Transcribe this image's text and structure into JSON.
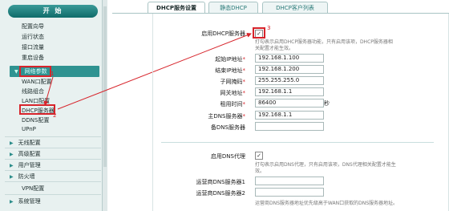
{
  "sidebar": {
    "start_label": "开 始",
    "top_items": [
      "配置向导",
      "运行状态",
      "接口流量",
      "重启设备"
    ],
    "network": {
      "label": "网络参数",
      "items": [
        "WAN口配置",
        "线路组合",
        "LAN口配置",
        "DHCP服务器",
        "DDNS配置",
        "UPnP"
      ]
    },
    "sections": [
      "无线配置",
      "高级配置",
      "用户管理",
      "防火墙",
      "VPN配置",
      "系统管理"
    ]
  },
  "annotations": {
    "one": "1",
    "two": "2",
    "three": "3"
  },
  "tabs": [
    "DHCP服务设置",
    "静态DHCP",
    "DHCP客户列表"
  ],
  "form": {
    "enable_dhcp_label": "启用DHCP服务器",
    "enable_dhcp_checked": true,
    "enable_dhcp_hint": "打勾表示启用DHCP服务器功能，只有启用该项，DHCP服务器相关配置才能生效。",
    "start_ip_label": "起始IP地址",
    "start_ip": "192.168.1.100",
    "end_ip_label": "结束IP地址",
    "end_ip": "192.168.1.200",
    "mask_label": "子网掩码",
    "mask": "255.255.255.0",
    "gateway_label": "网关地址",
    "gateway": "192.168.1.1",
    "lease_label": "租用时间",
    "lease": "86400",
    "lease_unit": "秒",
    "dns1_label": "主DNS服务器",
    "dns1": "192.168.1.1",
    "dns2_label": "备DNS服务器",
    "dns2": "",
    "enable_proxy_label": "启用DNS代理",
    "enable_proxy_checked": true,
    "enable_proxy_hint": "打勾表示启用DNS代理，只有启用该项，DNS代理相关配置才能生效。",
    "isp_dns1_label": "运营商DNS服务器1",
    "isp_dns1": "",
    "isp_dns2_label": "运营商DNS服务器2",
    "isp_dns2": "",
    "isp_dns_hint": "运营商DNS服务器地址优先级高于WAN口获取的DNS服务器地址。",
    "required_mark": "*"
  },
  "colors": {
    "accent": "#2f9391",
    "annotation": "#d7242b"
  }
}
